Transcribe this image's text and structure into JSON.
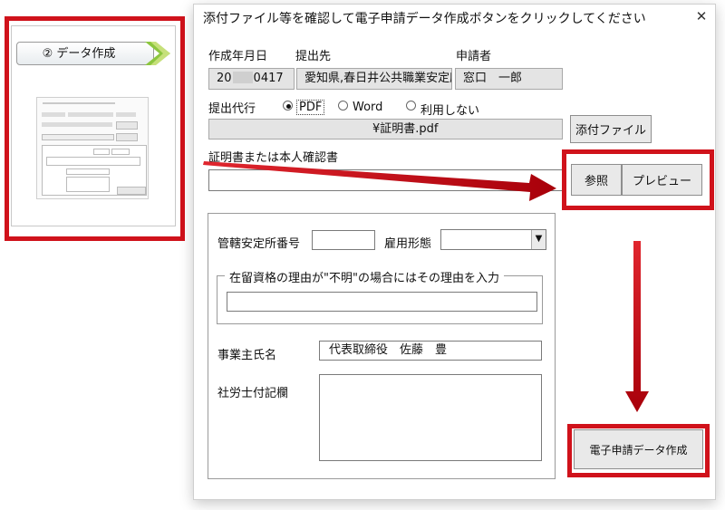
{
  "step": {
    "label": "② データ作成"
  },
  "dialog": {
    "title": "添付ファイル等を確認して電子申請データ作成ボタンをクリックしてください",
    "close_glyph": "✕",
    "headers": {
      "created_date": "作成年月日",
      "submit_to": "提出先",
      "applicant": "申請者"
    },
    "created_date_value": {
      "prefix": "20",
      "suffix": "0417"
    },
    "submit_to_value": "愛知県,春日井公共職業安定所",
    "applicant_value": "窓口　一郎",
    "proxy": {
      "label": "提出代行",
      "options": [
        "PDF",
        "Word",
        "利用しない"
      ],
      "selected": "PDF"
    },
    "attachment_path_suffix": "¥証明書.pdf",
    "attach_button": "添付ファイル",
    "certificate_label": "証明書または本人確認書",
    "browse_button": "参照",
    "preview_button": "プレビュー",
    "office_no_label": "管轄安定所番号",
    "employment_type_label": "雇用形態",
    "dropdown_glyph": "▼",
    "residence_group_label": "在留資格の理由が\"不明\"の場合にはその理由を入力",
    "employer_name_label": "事業主氏名",
    "employer_name_value": "代表取締役　佐藤　豊",
    "sharoushi_label": "社労士付記欄",
    "create_button": "電子申請データ作成"
  },
  "colors": {
    "highlight_red": "#d0121b",
    "arrow_start": "#e0262e",
    "arrow_end": "#a8000a"
  },
  "icons": {
    "step_chevron": "green-chevron-icon",
    "close": "close-icon",
    "dropdown": "chevron-down-icon"
  }
}
